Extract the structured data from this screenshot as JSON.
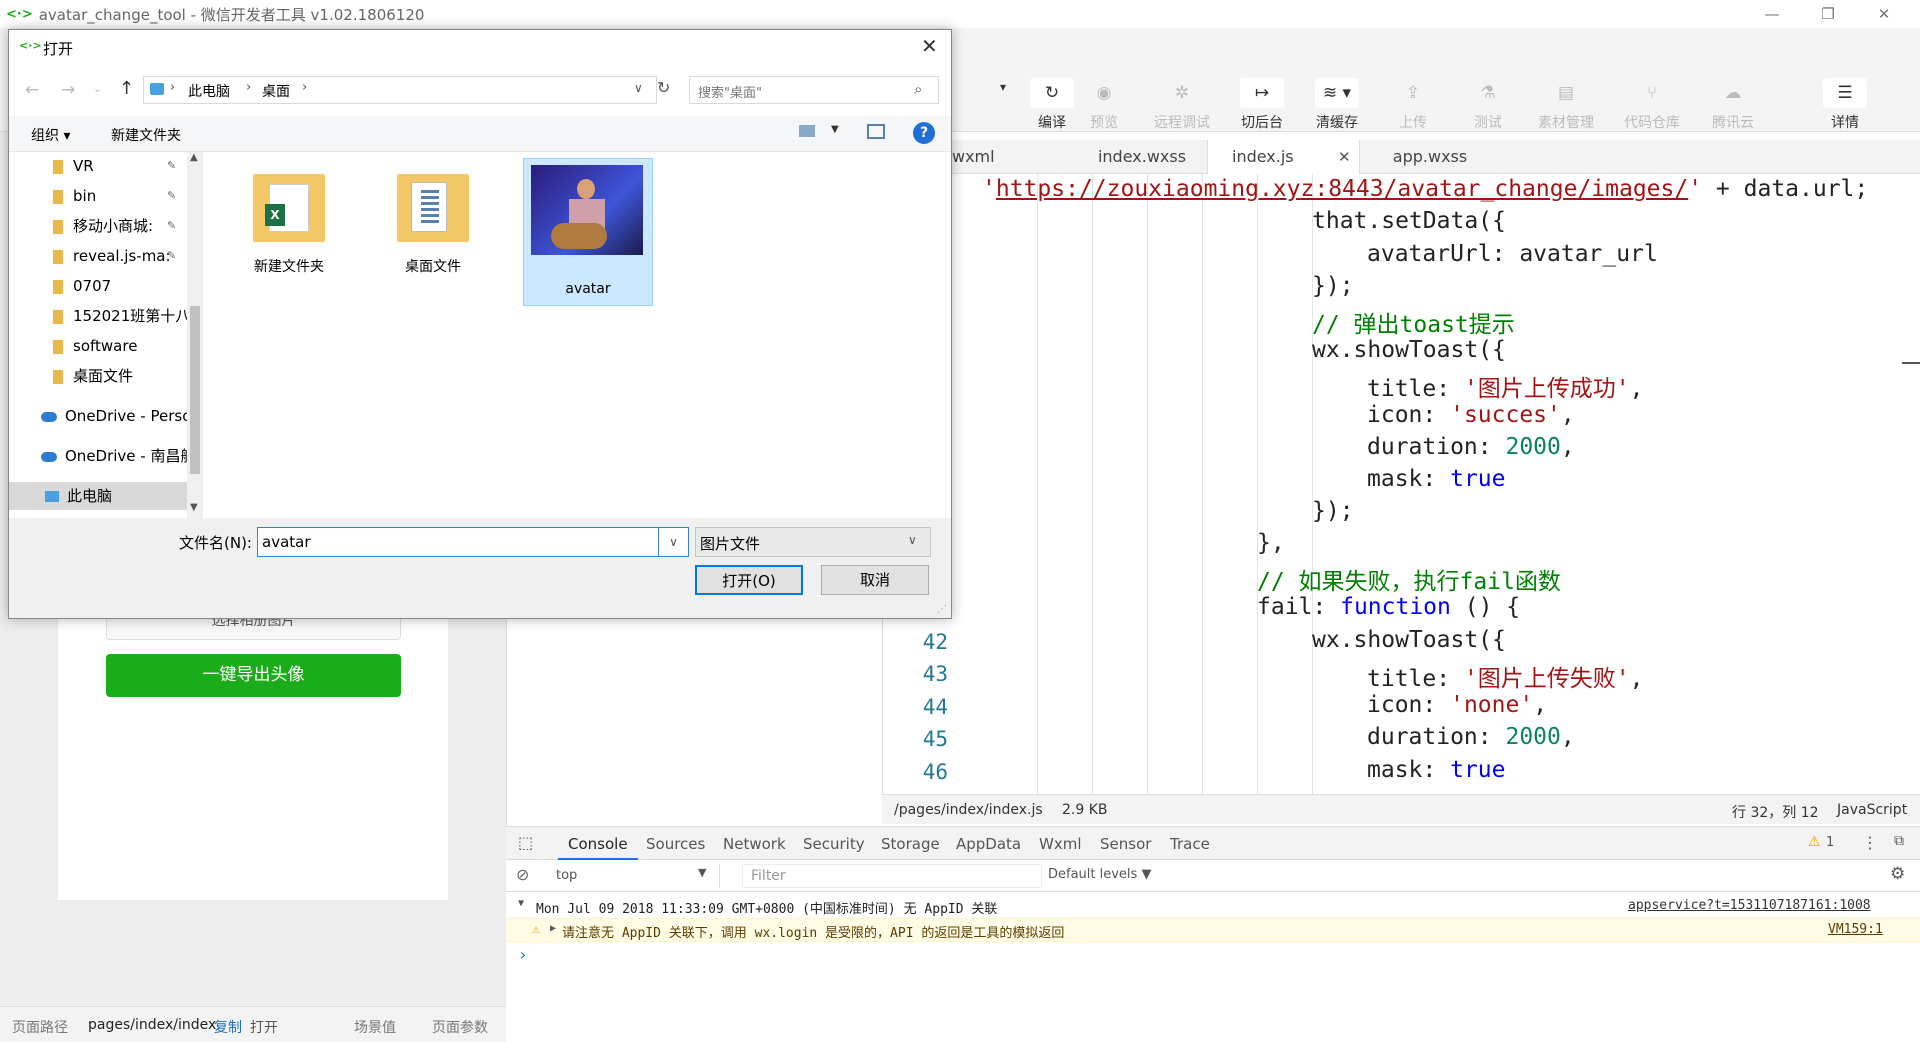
{
  "window": {
    "title": "avatar_change_tool - 微信开发者工具 v1.02.1806120",
    "logo": "<·>",
    "minimize": "—",
    "maximize": "❐",
    "close": "✕"
  },
  "toolbar": {
    "items": [
      {
        "label": "编译",
        "icon": "↻"
      },
      {
        "label": "预览",
        "icon": "◉"
      },
      {
        "label": "远程调试",
        "icon": "✲"
      },
      {
        "label": "切后台",
        "icon": "↦"
      },
      {
        "label": "清缓存",
        "icon": "≋ ▾"
      },
      {
        "label": "上传",
        "icon": "⇪"
      },
      {
        "label": "测试",
        "icon": "⚗"
      },
      {
        "label": "素材管理",
        "icon": "▤"
      },
      {
        "label": "代码仓库",
        "icon": "⑂"
      },
      {
        "label": "腾讯云",
        "icon": "☁"
      },
      {
        "label": "详情",
        "icon": "☰"
      }
    ],
    "dropdown_arrow": "▾"
  },
  "editor": {
    "tabs": [
      "wxml",
      "index.wxss",
      "index.js",
      "app.wxss"
    ],
    "active_tab": "index.js",
    "tab_close": "✕",
    "line_numbers": [
      "42",
      "43",
      "44",
      "45",
      "46"
    ],
    "code": {
      "l1_url": "https://zouxiaoming.xyz:8443/avatar_change/images/",
      "l1_rest": "' + data.url;",
      "l1_quote": "'",
      "l2": "that.setData({",
      "l3": "avatarUrl: avatar_url",
      "l4": "});",
      "l5": "// 弹出toast提示",
      "l6": "wx.showToast({",
      "l7_key": "title: ",
      "l7_val": "'图片上传成功'",
      "l8_key": "icon: ",
      "l8_val": "'succes'",
      "l9_key": "duration: ",
      "l9_val": "2000",
      "l10_key": "mask: ",
      "l10_val": "true",
      "l11": "});",
      "l12": "},",
      "l13": "// 如果失败，执行fail函数",
      "l14_key": "fail: ",
      "l14_kw": "function",
      "l14_rest": " () {",
      "l15": "wx.showToast({",
      "l16_key": "title: ",
      "l16_val": "'图片上传失败'",
      "l17_key": "icon: ",
      "l17_val": "'none'",
      "l18_key": "duration: ",
      "l18_val": "2000",
      "l19_key": "mask: ",
      "l19_val": "true",
      "comma": ","
    },
    "status": {
      "path": "/pages/index/index.js",
      "size": "2.9 KB",
      "position": "行 32，列 12",
      "language": "JavaScript"
    }
  },
  "simulator": {
    "button_hidden": "选择相册图片",
    "button_export": "一键导出头像"
  },
  "pathbar": {
    "label": "页面路径",
    "path": "pages/index/index",
    "copy": "复制",
    "open": "打开",
    "scene": "场景值",
    "params": "页面参数"
  },
  "devtools": {
    "tabs": [
      "Console",
      "Sources",
      "Network",
      "Security",
      "Storage",
      "AppData",
      "Wxml",
      "Sensor",
      "Trace"
    ],
    "active_tab": "Console",
    "warning_count": "1",
    "context": "top",
    "filter_placeholder": "Filter",
    "levels": "Default levels ▼",
    "log1": "Mon Jul 09 2018 11:33:09 GMT+0800 (中国标准时间) 无 AppID 关联",
    "log1_src": "appservice?t=1531107187161:1008",
    "log2": "请注意无 AppID 关联下，调用 wx.login 是受限的，API 的返回是工具的模拟返回",
    "log2_src": "VM159:1",
    "prompt": "›"
  },
  "dialog": {
    "title": "打开",
    "breadcrumb": [
      "此电脑",
      "桌面"
    ],
    "search_placeholder": "搜索\"桌面\"",
    "organize": "组织 ▾",
    "new_folder": "新建文件夹",
    "help": "?",
    "nav_items": [
      "VR",
      "bin",
      "移动小商城:",
      "reveal.js-ma:",
      "0707",
      "152021班第十八",
      "software",
      "桌面文件",
      "OneDrive - Perso",
      "OneDrive - 南昌航",
      "此电脑"
    ],
    "files": [
      "新建文件夹",
      "桌面文件",
      "avatar"
    ],
    "filename_label": "文件名(N):",
    "filename_value": "avatar",
    "filetype": "图片文件",
    "open_button": "打开(O)",
    "cancel_button": "取消"
  }
}
